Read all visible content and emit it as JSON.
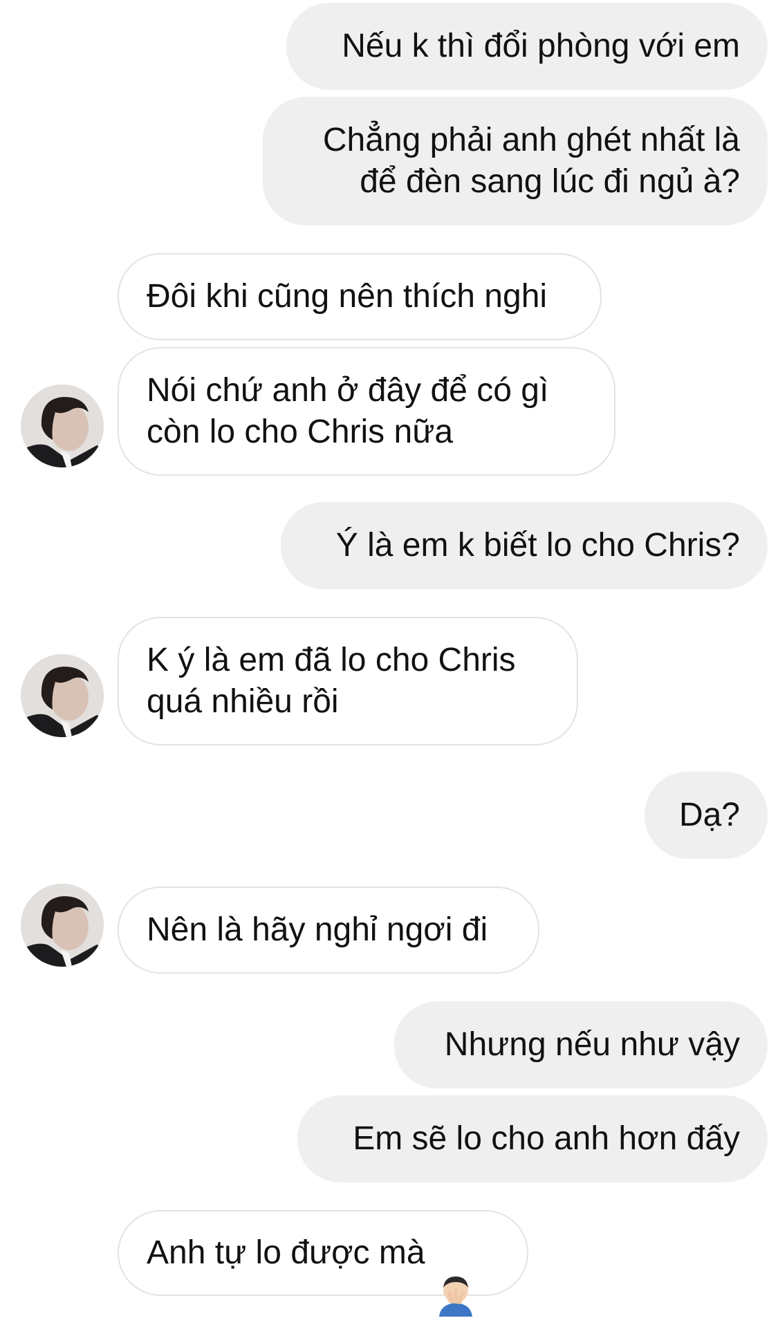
{
  "messages": [
    {
      "side": "sent",
      "text": "Nếu k thì đổi phòng với em"
    },
    {
      "side": "sent",
      "text": "Chẳng phải anh ghét nhất là\nđể đèn sang lúc đi ngủ à?"
    },
    {
      "side": "received",
      "text": "Đôi khi cũng nên thích nghi"
    },
    {
      "side": "received",
      "text": "Nói chứ anh ở đây để có gì\ncòn lo cho Chris nữa"
    },
    {
      "side": "sent",
      "text": "Ý là em k biết lo cho Chris?"
    },
    {
      "side": "received",
      "text": "K ý là em đã lo cho Chris\nquá nhiều rồi"
    },
    {
      "side": "sent",
      "text": "Dạ?"
    },
    {
      "side": "received",
      "text": "Nên là hãy nghỉ ngơi đi"
    },
    {
      "side": "sent",
      "text": "Nhưng nếu như vậy"
    },
    {
      "side": "sent",
      "text": "Em sẽ lo cho anh hơn đấy"
    },
    {
      "side": "received",
      "text": "Anh tự lo được mà",
      "emoji": "man-facepalming-emoji"
    }
  ],
  "colors": {
    "sent_bubble": "#efefef",
    "received_border": "#e3e3e3",
    "text": "#111111"
  }
}
